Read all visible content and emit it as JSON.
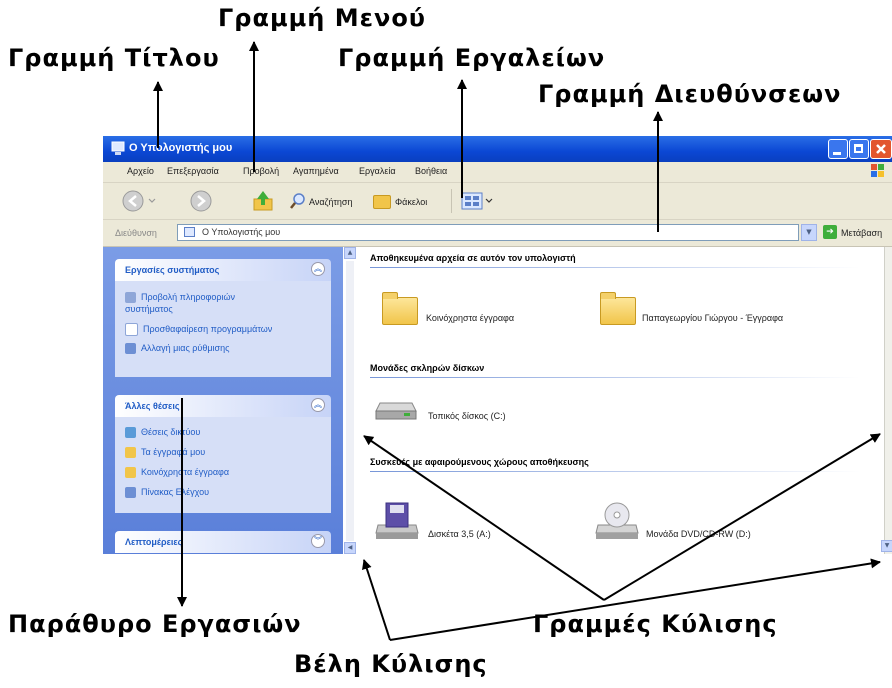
{
  "callouts": {
    "menu_bar": "Γραμμή Μενού",
    "title_bar": "Γραμμή Τίτλου",
    "toolbar": "Γραμμή Εργαλείων",
    "address_bar": "Γραμμή Διευθύνσεων",
    "task_pane": "Παράθυρο Εργασιών",
    "scrollbars": "Γραμμές Κύλισης",
    "scroll_arrows": "Βέλη Κύλισης"
  },
  "window": {
    "title": "Ο Υπολογιστής μου",
    "menu": [
      "Αρχείο",
      "Επεξεργασία",
      "Προβολή",
      "Αγαπημένα",
      "Εργαλεία",
      "Βοήθεια"
    ],
    "toolbar": {
      "search_label": "Αναζήτηση",
      "folders_label": "Φάκελοι"
    },
    "address": {
      "label": "Διεύθυνση",
      "value": "Ο Υπολογιστής μου",
      "go_label": "Μετάβαση"
    },
    "task_pane": {
      "panels": [
        {
          "title": "Εργασίες συστήματος",
          "items": [
            "Προβολή πληροφοριών συστήματος",
            "Προσθαφαίρεση προγραμμάτων",
            "Αλλαγή μιας ρύθμισης"
          ]
        },
        {
          "title": "Άλλες θέσεις",
          "items": [
            "Θέσεις δικτύου",
            "Τα έγγραφά μου",
            "Κοινόχρηστα έγγραφα",
            "Πίνακας Ελέγχου"
          ]
        },
        {
          "title": "Λεπτομέρειες",
          "items": []
        }
      ]
    },
    "content": {
      "groups": [
        {
          "title": "Αποθηκευμένα αρχεία σε αυτόν τον υπολογιστή",
          "items": [
            "Κοινόχρηστα έγγραφα",
            "Παπαγεωργίου Γιώργου - Έγγραφα"
          ]
        },
        {
          "title": "Μονάδες σκληρών δίσκων",
          "items": [
            "Τοπικός δίσκος (C:)"
          ]
        },
        {
          "title": "Συσκευές με αφαιρούμενους χώρους αποθήκευσης",
          "items": [
            "Δισκέτα 3,5 (A:)",
            "Μονάδα DVD/CD-RW (D:)"
          ]
        }
      ]
    }
  },
  "colors": {
    "titlebar": "#0b47d4",
    "taskpane": "#6a8de0",
    "link": "#215dc6"
  }
}
